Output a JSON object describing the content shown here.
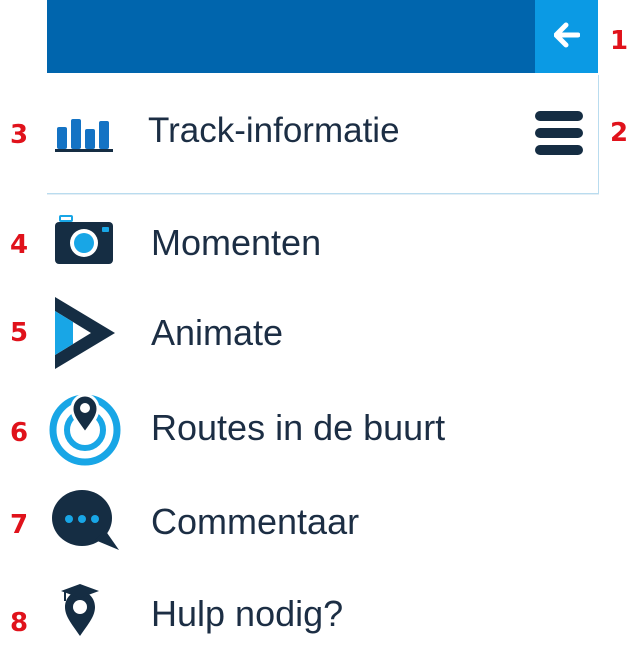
{
  "colors": {
    "topbar": "#0065ad",
    "back_button": "#0b9ae4",
    "text": "#1c2e44",
    "icon_dark": "#152d43",
    "icon_accent": "#18a6e6",
    "annotation": "#e0121b"
  },
  "annotations": [
    "1",
    "2",
    "3",
    "4",
    "5",
    "6",
    "7",
    "8"
  ],
  "topbar": {
    "back_icon": "arrow-left-icon"
  },
  "panel": {
    "title": "Track-informatie",
    "icon": "bar-chart-icon",
    "menu_icon": "hamburger-icon"
  },
  "menu": [
    {
      "label": "Momenten",
      "icon": "camera-icon"
    },
    {
      "label": "Animate",
      "icon": "play-icon"
    },
    {
      "label": "Routes in de buurt",
      "icon": "location-radar-icon"
    },
    {
      "label": "Commentaar",
      "icon": "chat-bubble-icon"
    },
    {
      "label": "Hulp nodig?",
      "icon": "graduation-pin-icon"
    }
  ]
}
